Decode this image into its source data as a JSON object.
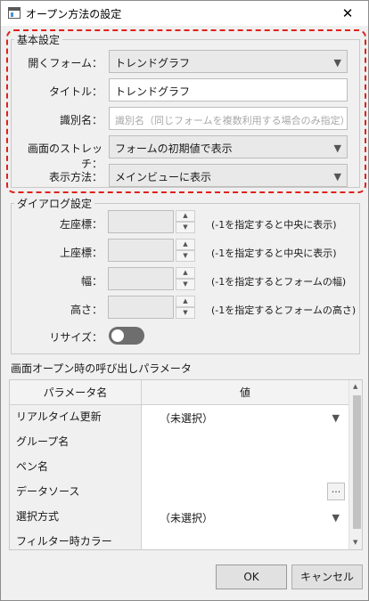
{
  "window": {
    "title": "オープン方法の設定",
    "close_glyph": "✕"
  },
  "basic": {
    "group_label": "基本設定",
    "open_form": {
      "label": "開くフォーム：",
      "value": "トレンドグラフ"
    },
    "title_field": {
      "label": "タイトル：",
      "value": "トレンドグラフ"
    },
    "identifier": {
      "label": "識別名：",
      "placeholder": "識別名（同じフォームを複数利用する場合のみ指定）"
    },
    "stretch": {
      "label": "画面のストレッチ：",
      "value": "フォームの初期値で表示"
    },
    "display_method": {
      "label": "表示方法：",
      "value": "メインビューに表示"
    }
  },
  "dialog": {
    "group_label": "ダイアログ設定",
    "left": {
      "label": "左座標：",
      "note": "(-1を指定すると中央に表示)"
    },
    "top": {
      "label": "上座標：",
      "note": "(-1を指定すると中央に表示)"
    },
    "width": {
      "label": "幅：",
      "note": "(-1を指定するとフォームの幅)"
    },
    "height": {
      "label": "高さ：",
      "note": "(-1を指定するとフォームの高さ)"
    },
    "resize": {
      "label": "リサイズ：",
      "on": false
    }
  },
  "params": {
    "section_title": "画面オープン時の呼び出しパラメータ",
    "col_name": "パラメータ名",
    "col_value": "値",
    "rows": [
      {
        "name": "リアルタイム更新",
        "value": "（未選択）"
      },
      {
        "name": "グループ名",
        "value": ""
      },
      {
        "name": "ペン名",
        "value": ""
      },
      {
        "name": "データソース",
        "value": "",
        "ellipsis": "..."
      },
      {
        "name": "選択方式",
        "value": "（未選択）"
      },
      {
        "name": "フィルター時カラー",
        "value": ""
      }
    ]
  },
  "buttons": {
    "ok": "OK",
    "cancel": "キャンセル"
  },
  "icons": {
    "dropdown": "chevron-down-icon",
    "spin_up": "spin-up-icon",
    "spin_down": "spin-down-icon"
  },
  "colors": {
    "highlight": "#e0201a",
    "toggle_off": "#6e6e6e"
  }
}
